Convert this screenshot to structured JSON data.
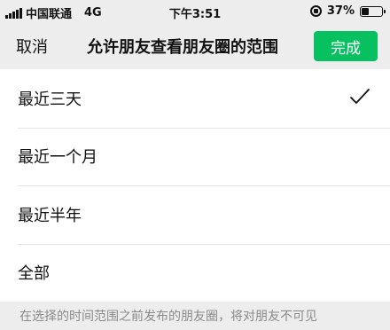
{
  "status_bar": {
    "carrier": "中国联通",
    "network": "4G",
    "time": "下午3:51",
    "battery_text": "37%",
    "battery_level": 0.37,
    "icons": [
      "signal-icon",
      "orientation-lock-icon",
      "battery-icon"
    ]
  },
  "nav": {
    "cancel_label": "取消",
    "title": "允许朋友查看朋友圈的范围",
    "done_label": "完成"
  },
  "options": [
    {
      "label": "最近三天",
      "selected": true
    },
    {
      "label": "最近一个月",
      "selected": false
    },
    {
      "label": "最近半年",
      "selected": false
    },
    {
      "label": "全部",
      "selected": false
    }
  ],
  "footer_note": "在选择的时间范围之前发布的朋友圈，将对朋友不可见",
  "colors": {
    "accent": "#07c160",
    "background": "#ededed",
    "list_background": "#ffffff",
    "note_text": "#8a8a8a"
  }
}
